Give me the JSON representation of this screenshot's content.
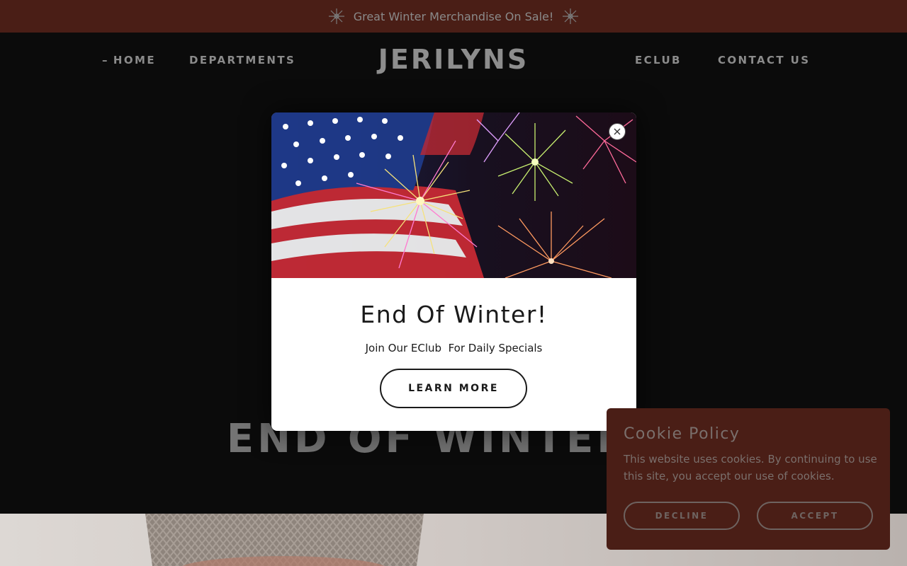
{
  "announcement": {
    "text": "Great Winter Merchandise On Sale!",
    "icon_left": "snowflake-icon",
    "icon_right": "snowflake-icon"
  },
  "header": {
    "logo": "JERILYNS",
    "nav": {
      "home": "HOME",
      "home_marker": "–",
      "departments": "DEPARTMENTS",
      "eclub": "ECLUB",
      "contact": "CONTACT US"
    }
  },
  "hero": {
    "title": "END OF WINTER S"
  },
  "modal": {
    "title": "End Of Winter!",
    "subtitle": "Join Our EClub  For Daily Specials",
    "button_label": "LEARN MORE",
    "close_icon": "close-icon",
    "image": "flag-and-fireworks-image"
  },
  "cookie": {
    "title": "Cookie Policy",
    "text": "This website uses cookies. By continuing to use this site, you accept our use of cookies.",
    "decline_label": "DECLINE",
    "accept_label": "ACCEPT"
  },
  "colors": {
    "announce_bg": "#4a1e16",
    "page_bg": "#0b0b0b",
    "nav_text": "#8b8b8b",
    "cookie_bg": "#4a1e16",
    "modal_bg": "#ffffff"
  }
}
